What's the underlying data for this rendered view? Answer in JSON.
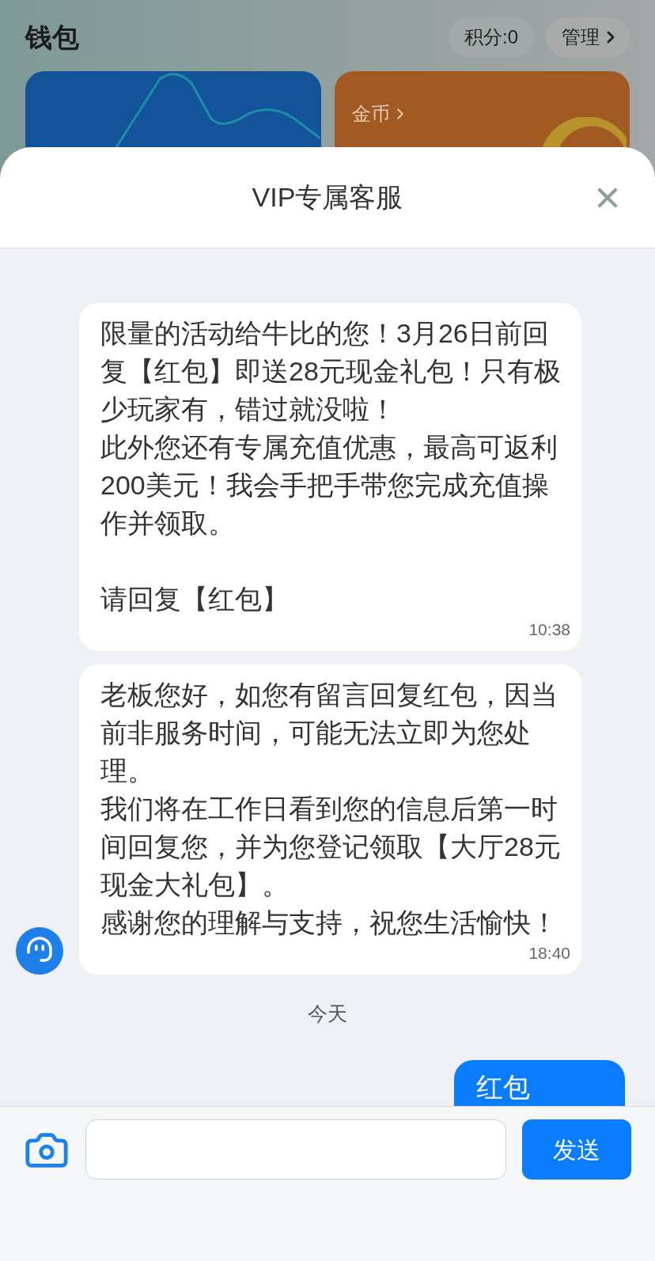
{
  "background_page": {
    "title": "钱包",
    "points_pill": "积分:0",
    "manage_pill": "管理",
    "cards": [
      {
        "kind": "chart"
      },
      {
        "kind": "coins",
        "label": "金币"
      }
    ]
  },
  "sheet": {
    "title": "VIP专属客服"
  },
  "messages": [
    {
      "kind": "incoming",
      "show_avatar": false,
      "paragraphs": [
        "限量的活动给牛比的您！3月26日前回复【红包】即送28元现金礼包！只有极少玩家有，错过就没啦！",
        "此外您还有专属充值优惠，最高可返利200美元！我会手把手带您完成充值操作并领取。"
      ],
      "closing": "请回复【红包】",
      "time": "10:38"
    },
    {
      "kind": "incoming",
      "show_avatar": true,
      "paragraphs": [
        "老板您好，如您有留言回复红包，因当前非服务时间，可能无法立即为您处理。",
        "我们将在工作日看到您的信息后第一时间回复您，并为您登记领取【大厅28元现金大礼包】。",
        "感谢您的理解与支持，祝您生活愉快！"
      ],
      "time": "18:40"
    },
    {
      "kind": "date",
      "text": "今天"
    },
    {
      "kind": "outgoing",
      "text": "红包"
    }
  ],
  "composer": {
    "send_button": "发送"
  }
}
